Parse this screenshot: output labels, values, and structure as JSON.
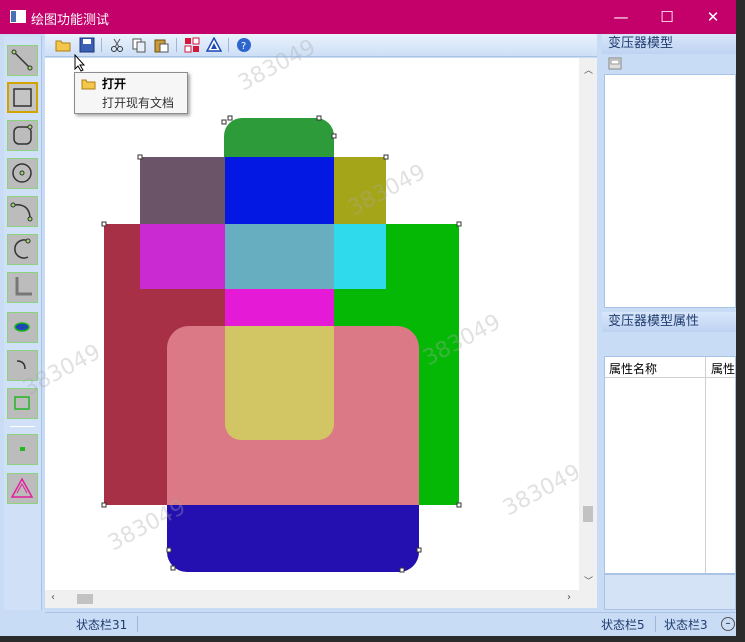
{
  "window": {
    "title": "绘图功能测试",
    "controls": {
      "minimize": "—",
      "maximize": "☐",
      "close": "✕"
    }
  },
  "toolbar": {
    "buttons": [
      "open-icon",
      "save-icon",
      "cut-icon",
      "copy-icon",
      "paste-icon",
      "grid-icon",
      "shape-icon",
      "help-icon"
    ]
  },
  "tooltip": {
    "title": "打开",
    "description": "打开现有文档"
  },
  "left_toolbox": {
    "tools": [
      "line-tool",
      "rectangle-tool",
      "rounded-rect-tool",
      "circle-tool",
      "arc-tool",
      "curve-arrow-tool",
      "corner-tool",
      "ellipse-tool",
      "hook-tool",
      "small-rect-tool",
      "point-tool",
      "triangle-tool"
    ]
  },
  "right_panel": {
    "model_title": "变压器模型",
    "properties_title": "变压器模型属性",
    "table_headers": [
      "属性名称",
      "属性"
    ]
  },
  "statusbar": {
    "left": "状态栏31",
    "right1": "状态栏5",
    "right2": "状态栏3"
  },
  "watermark": "383049",
  "colors": {
    "titlebar": "#c4006a",
    "green_tab": "#2e9b3a",
    "mauve": "#6b5468",
    "blue": "#0418e4",
    "olive": "#a5a519",
    "crimson": "#a83046",
    "magenta": "#c92ad1",
    "steel": "#67afc0",
    "cyan": "#2fdaec",
    "green": "#04b805",
    "pink": "#e51ad6",
    "salmon": "#dc7987",
    "yellow": "#d2c664",
    "navy": "#2410b0"
  }
}
